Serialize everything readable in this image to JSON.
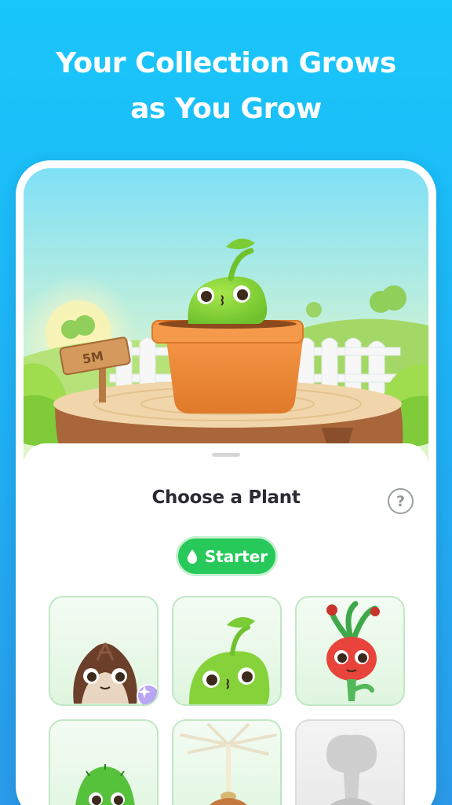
{
  "headline": {
    "line1": "Your Collection Grows",
    "line2": "as You Grow"
  },
  "scene": {
    "sign_label": "5M"
  },
  "sheet": {
    "title": "Choose a Plant",
    "help_label": "?",
    "filter_label": "Starter",
    "filter_icon": "water-drop-icon"
  },
  "plants": [
    {
      "name": "acorn-seed-plant",
      "state": "unlocked",
      "badge": "sparkle-icon"
    },
    {
      "name": "green-sprout-plant",
      "state": "unlocked",
      "selected": true
    },
    {
      "name": "radish-plant",
      "state": "unlocked"
    },
    {
      "name": "cactus-plant",
      "state": "unlocked"
    },
    {
      "name": "dandelion-plant",
      "state": "unlocked"
    },
    {
      "name": "mystery-plant",
      "state": "locked"
    }
  ],
  "colors": {
    "background": "#1faef3",
    "accent_green": "#27c95a",
    "pot": "#ef8a3a",
    "sprout": "#8bd63a"
  }
}
